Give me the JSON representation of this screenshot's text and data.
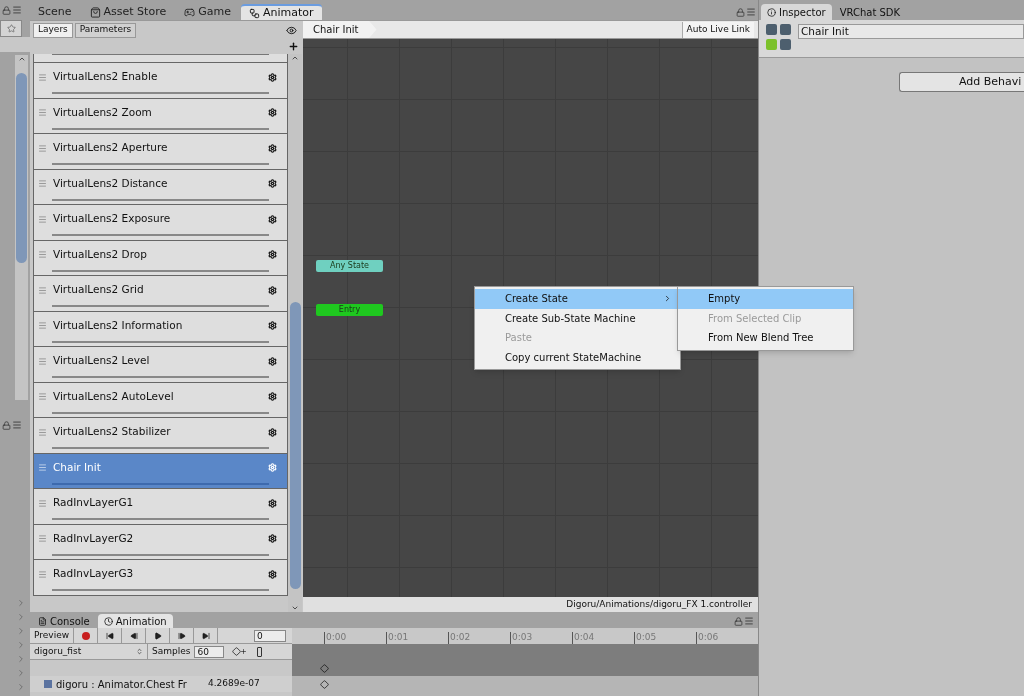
{
  "top_tabs": [
    {
      "label": "Scene",
      "selected": false
    },
    {
      "label": "Asset Store",
      "selected": false
    },
    {
      "label": "Game",
      "selected": false
    },
    {
      "label": "Animator",
      "selected": true
    }
  ],
  "animator": {
    "sidebar_tabs": [
      {
        "label": "Layers",
        "selected": true
      },
      {
        "label": "Parameters",
        "selected": false
      }
    ],
    "layers": [
      {
        "name": "VirtualLens2 Enable",
        "selected": false
      },
      {
        "name": "VirtualLens2 Zoom",
        "selected": false
      },
      {
        "name": "VirtualLens2 Aperture",
        "selected": false
      },
      {
        "name": "VirtualLens2 Distance",
        "selected": false
      },
      {
        "name": "VirtualLens2 Exposure",
        "selected": false
      },
      {
        "name": "VirtualLens2 Drop",
        "selected": false
      },
      {
        "name": "VirtualLens2 Grid",
        "selected": false
      },
      {
        "name": "VirtualLens2 Information",
        "selected": false
      },
      {
        "name": "VirtualLens2 Level",
        "selected": false
      },
      {
        "name": "VirtualLens2 AutoLevel",
        "selected": false
      },
      {
        "name": "VirtualLens2 Stabilizer",
        "selected": false
      },
      {
        "name": "Chair Init",
        "selected": true
      },
      {
        "name": "RadInvLayerG1",
        "selected": false
      },
      {
        "name": "RadInvLayerG2",
        "selected": false
      },
      {
        "name": "RadInvLayerG3",
        "selected": false
      }
    ],
    "breadcrumb": "Chair Init",
    "auto_live_link": "Auto Live Link",
    "nodes": [
      {
        "label": "Any State",
        "kind": "any"
      },
      {
        "label": "Entry",
        "kind": "entry"
      }
    ],
    "context_menu": [
      {
        "label": "Create State",
        "disabled": false,
        "selected": true,
        "has_submenu": true
      },
      {
        "label": "Create Sub-State Machine",
        "disabled": false,
        "selected": false,
        "has_submenu": false
      },
      {
        "label": "Paste",
        "disabled": true,
        "selected": false,
        "has_submenu": false
      },
      {
        "label": "Copy current StateMachine",
        "disabled": false,
        "selected": false,
        "has_submenu": false
      }
    ],
    "submenu": [
      {
        "label": "Empty",
        "disabled": false,
        "selected": true
      },
      {
        "label": "From Selected Clip",
        "disabled": true,
        "selected": false
      },
      {
        "label": "From New Blend Tree",
        "disabled": false,
        "selected": false
      }
    ],
    "footer_path": "Digoru/Animations/digoru_FX 1.controller"
  },
  "inspector": {
    "tabs": [
      {
        "label": "Inspector",
        "selected": true
      },
      {
        "label": "VRChat SDK",
        "selected": false
      }
    ],
    "name": "Chair Init",
    "button": "Add Behavi"
  },
  "animation": {
    "tabs": [
      {
        "label": "Console",
        "selected": false
      },
      {
        "label": "Animation",
        "selected": true
      }
    ],
    "preview": "Preview",
    "frame": "0",
    "clip": "digoru_fist",
    "samples_label": "Samples",
    "samples": "60",
    "ticks": [
      "0:00",
      "0:01",
      "0:02",
      "0:03",
      "0:04",
      "0:05",
      "0:06"
    ],
    "properties": [
      {
        "name": "digoru : Animator.Chest Fr",
        "value": "4.2689e-07"
      }
    ]
  }
}
